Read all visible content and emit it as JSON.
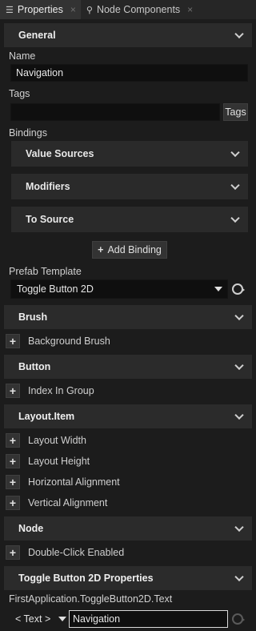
{
  "tabs": [
    {
      "label": "Properties",
      "icon": "list-icon",
      "close": "×"
    },
    {
      "label": "Node Components",
      "icon": "node-components-icon",
      "close": "×"
    }
  ],
  "general": {
    "header": "General",
    "name_label": "Name",
    "name_value": "Navigation",
    "tags_label": "Tags",
    "tags_value": "",
    "tags_button": "Tags",
    "bindings_label": "Bindings",
    "value_sources": "Value Sources",
    "modifiers": "Modifiers",
    "to_source": "To Source",
    "add_binding_icon": "+",
    "add_binding": "Add Binding",
    "prefab_label": "Prefab Template",
    "prefab_value": "Toggle Button 2D"
  },
  "brush": {
    "header": "Brush",
    "items": [
      "Background Brush"
    ]
  },
  "button": {
    "header": "Button",
    "items": [
      "Index In Group"
    ]
  },
  "layout_item": {
    "header": "Layout.Item",
    "items": [
      "Layout Width",
      "Layout Height",
      "Horizontal Alignment",
      "Vertical Alignment"
    ]
  },
  "node": {
    "header": "Node",
    "items": [
      "Double-Click Enabled"
    ]
  },
  "toggle": {
    "header": "Toggle Button 2D Properties",
    "property_path": "FirstApplication.ToggleButton2D.Text",
    "type_value": "< Text >",
    "text_value": "Navigation"
  },
  "plus_glyph": "+",
  "colors": {
    "background": "#1c1c1c",
    "section_header": "#2b2b2b",
    "field": "#0f0f0f",
    "text": "#d8d8d8"
  }
}
